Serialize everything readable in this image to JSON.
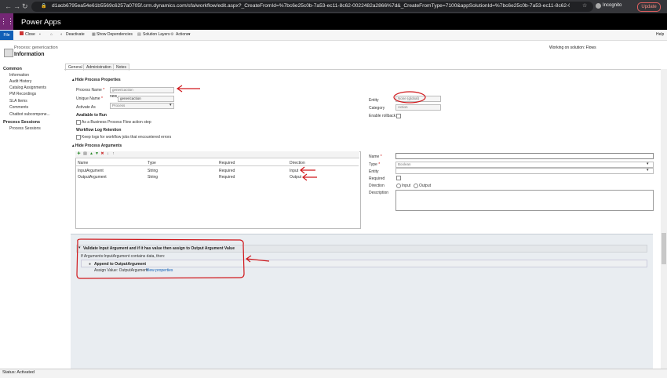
{
  "browser": {
    "url": "d1acb6795ea54e61b5569c6257a0705f.crm.dynamics.com/sfa/workflow/edit.aspx?_CreateFromId=%7bc6e25c0b-7a53-ec11-8c62-0022482a2866%7d&_CreateFromType=7100&appSolutionId=%7bc6e25c0b-7a53-ec11-8c62-0022482a...",
    "incognito": "Incognito",
    "update": "Update"
  },
  "app": {
    "title": "Power Apps",
    "help": "Help"
  },
  "commands": {
    "file": "File",
    "close": "Close",
    "save": "",
    "deactivate": "Deactivate",
    "show_dependencies": "Show Dependencies",
    "solution_layers": "Solution Layers",
    "actions": "Actions"
  },
  "header": {
    "process_name": "Process: genericaction",
    "title": "Information",
    "working_on": "Working on solution: Flows"
  },
  "nav": {
    "common": "Common",
    "items": [
      "Information",
      "Audit History",
      "Catalog Assignments",
      "PM Recordings",
      "SLA Items",
      "Comments",
      "Chatbot subcompone..."
    ],
    "sessions": "Process Sessions",
    "session_items": [
      "Process Sessions"
    ]
  },
  "tabs": [
    "General",
    "Administration",
    "Notes"
  ],
  "props": {
    "section": "Hide Process Properties",
    "process_name_label": "Process Name",
    "process_name_value": "genericaction",
    "unique_name_label": "Unique Name",
    "unique_name_prefix": "new_",
    "unique_name_value": "genericaction",
    "activate_as_label": "Activate As",
    "activate_as_value": "Process",
    "available_label": "Available to Run",
    "available_option": "As a Business Process Flow action step",
    "log_label": "Workflow Log Retention",
    "log_option": "Keep logs for workflow jobs that encountered errors",
    "entity_label": "Entity",
    "entity_value": "None (global)",
    "category_label": "Category",
    "category_value": "Action",
    "rollback_label": "Enable rollback"
  },
  "args": {
    "section": "Hide Process Arguments",
    "headers": [
      "Name",
      "Type",
      "Required",
      "Direction"
    ],
    "rows": [
      {
        "name": "InputArgument",
        "type": "String",
        "required": "Required",
        "direction": "Input"
      },
      {
        "name": "OutputArgument",
        "type": "String",
        "required": "Required",
        "direction": "Output"
      }
    ]
  },
  "detail": {
    "name_label": "Name",
    "type_label": "Type",
    "type_value": "Boolean",
    "entity_label": "Entity",
    "required_label": "Required",
    "direction_label": "Direction",
    "dir_input": "Input",
    "dir_output": "Output",
    "description_label": "Description"
  },
  "designer": {
    "step_title": "Validate Input Argument and if it has value then assign to Output Argument Value",
    "condition": "If Arguments:InputArgument contains data, then:",
    "action": "Append to OutputArgument",
    "assign": "Assign Value:  OutputArgument",
    "view_props": "View properties"
  },
  "status": "Status: Activated",
  "colors": {
    "brand": "#742774",
    "file": "#1160b7",
    "annotation": "#d0181c"
  }
}
